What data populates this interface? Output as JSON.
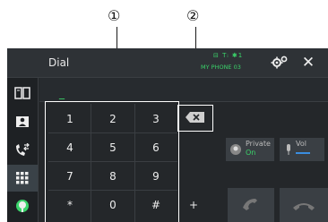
{
  "callouts": [
    "①",
    "②"
  ],
  "header": {
    "title": "Dial",
    "phone_status_icons": "⊟ Tᵢ ✱1",
    "phone_name": "MY PHONE 03"
  },
  "input": {
    "value": "_"
  },
  "keypad": {
    "keys": [
      "1",
      "2",
      "3",
      "4",
      "5",
      "6",
      "7",
      "8",
      "9",
      "*",
      "0",
      "#",
      "+"
    ]
  },
  "private": {
    "label": "Private",
    "value": "On"
  },
  "volume": {
    "label": "Vol",
    "level_fraction": 0.6
  },
  "colors": {
    "accent_green": "#3ad36a",
    "accent_blue": "#3a8de0"
  }
}
